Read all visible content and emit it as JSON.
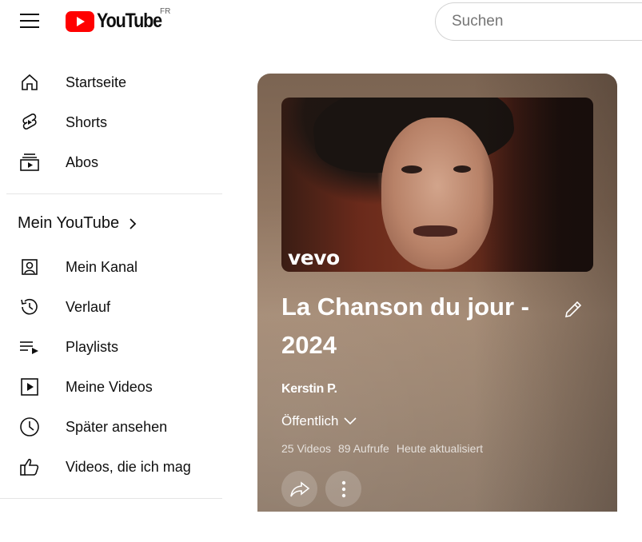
{
  "header": {
    "logo_text": "YouTube",
    "country_code": "FR",
    "search_placeholder": "Suchen"
  },
  "sidebar": {
    "top_items": [
      {
        "label": "Startseite",
        "icon": "home-icon"
      },
      {
        "label": "Shorts",
        "icon": "shorts-icon"
      },
      {
        "label": "Abos",
        "icon": "subscriptions-icon"
      }
    ],
    "section_title": "Mein YouTube",
    "section_items": [
      {
        "label": "Mein Kanal",
        "icon": "channel-icon"
      },
      {
        "label": "Verlauf",
        "icon": "history-icon"
      },
      {
        "label": "Playlists",
        "icon": "playlists-icon"
      },
      {
        "label": "Meine Videos",
        "icon": "my-videos-icon"
      },
      {
        "label": "Später ansehen",
        "icon": "watch-later-icon"
      },
      {
        "label": "Videos, die ich mag",
        "icon": "thumbs-up-icon"
      }
    ]
  },
  "playlist": {
    "thumbnail_watermark": "vevo",
    "title": "La Chanson du jour - 2024",
    "owner": "Kerstin P.",
    "privacy": "Öffentlich",
    "video_count": "25 Videos",
    "views": "89 Aufrufe",
    "updated": "Heute aktualisiert"
  },
  "colors": {
    "logo_red": "#ff0000",
    "card_bg": "#8e735e"
  }
}
